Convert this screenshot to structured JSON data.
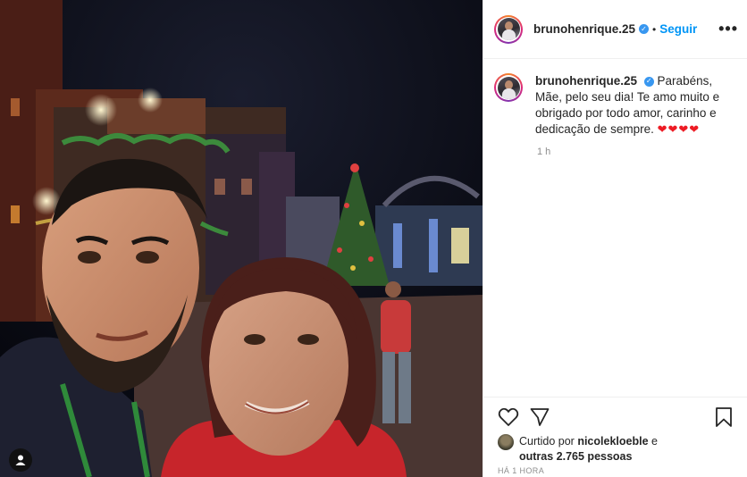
{
  "post": {
    "username": "brunohenrique.25",
    "follow_label": "Seguir",
    "more_label": "•••",
    "separator": "•",
    "caption_text": "Parabéns, Mãe, pelo seu dia! Te amo muito e obrigado por todo amor, carinho e dedicação de sempre.",
    "caption_hearts": "❤❤❤❤",
    "comment_time": "1 h",
    "liked_by_prefix": "Curtido por",
    "liked_by_user": "nicolekloeble",
    "liked_by_suffix": "e",
    "liked_by_others": "outras 2.765 pessoas",
    "post_time": "HÁ 1 HORA"
  },
  "icons": {
    "verified": "verified-badge-icon",
    "like": "heart-outline-icon",
    "share": "paper-plane-icon",
    "save": "bookmark-icon",
    "user_tag": "user-tag-icon",
    "more": "more-options-icon"
  },
  "colors": {
    "accent_blue": "#0095f6",
    "verified_blue": "#3897f0",
    "heart_red": "#ed1b24",
    "muted_text": "#8e8e8e",
    "text": "#262626"
  }
}
